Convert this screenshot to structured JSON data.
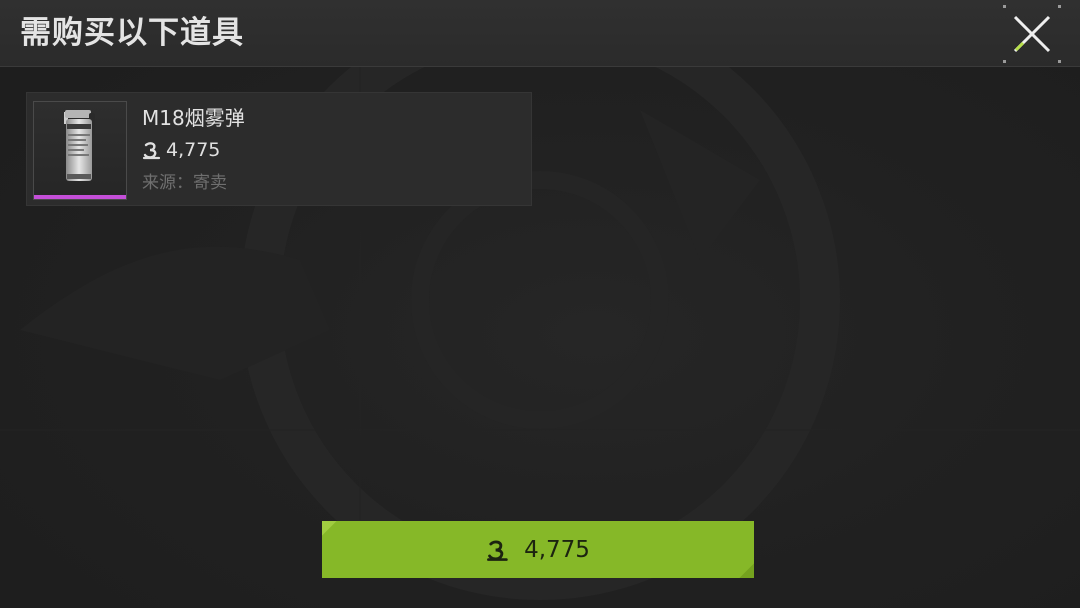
{
  "dialog": {
    "title": "需购买以下道具",
    "close_icon": "close-x-icon",
    "accent_color": "#b8e04a"
  },
  "item": {
    "name": "M18烟雾弹",
    "price": "4,775",
    "currency_icon": "coin-currency-icon",
    "source": "来源：寄卖",
    "thumbnail_icon": "smoke-grenade-icon",
    "rarity_color": "#c44fd8"
  },
  "buy_button": {
    "price": "4,775",
    "currency_icon": "coin-currency-icon",
    "color": "#86b828"
  }
}
